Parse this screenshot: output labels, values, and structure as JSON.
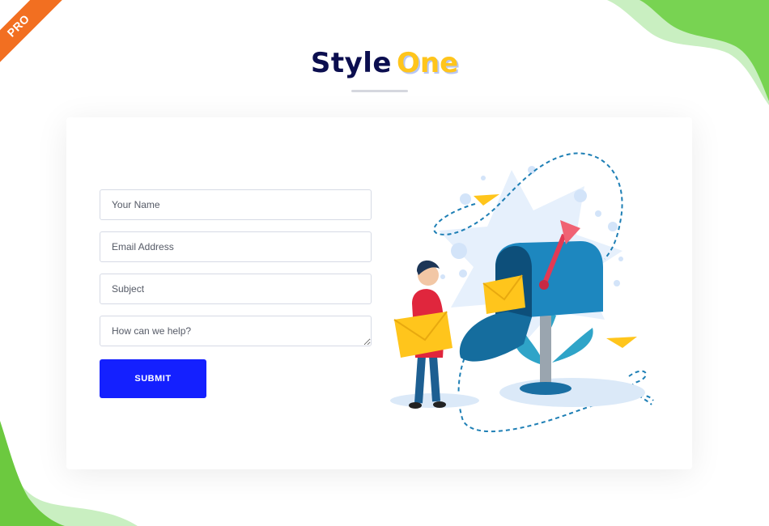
{
  "badge": {
    "label": "PRO",
    "color": "#f26f21"
  },
  "heading": {
    "part1": "Style",
    "part2": "One",
    "color_primary": "#0b0e4f",
    "color_accent": "#ffc51c"
  },
  "form": {
    "name_placeholder": "Your Name",
    "email_placeholder": "Email Address",
    "subject_placeholder": "Subject",
    "message_placeholder": "How can we help?",
    "submit_label": "SUBMIT",
    "submit_color": "#1420ff"
  },
  "illustration": {
    "subject": "person-carrying-envelope-next-to-mailbox"
  },
  "decor": {
    "blob_color": "#7ed957"
  }
}
